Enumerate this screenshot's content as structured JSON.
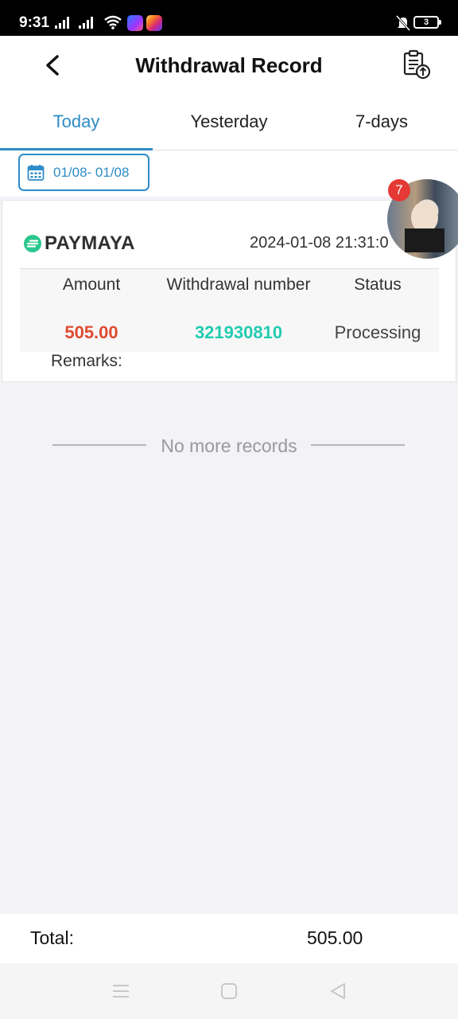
{
  "status_bar": {
    "time": "9:31",
    "battery": "3",
    "icons": [
      "signal-icon",
      "signal-icon",
      "wifi-icon",
      "messenger-icon",
      "instagram-icon",
      "mute-icon",
      "battery-icon"
    ]
  },
  "header": {
    "title": "Withdrawal Record",
    "back_icon": "chevron-left-icon",
    "record_icon": "clipboard-upload-icon"
  },
  "tabs": [
    {
      "label": "Today",
      "active": true
    },
    {
      "label": "Yesterday",
      "active": false
    },
    {
      "label": "7-days",
      "active": false
    }
  ],
  "filter": {
    "date_range": "01/08- 01/08",
    "icon": "calendar-icon"
  },
  "records": [
    {
      "method": "PAYMAYA",
      "time": "2024-01-08 21:31:0",
      "headers": {
        "amount": "Amount",
        "number": "Withdrawal number",
        "status": "Status"
      },
      "amount": "505.00",
      "number": "321930810",
      "status": "Processing",
      "remarks_label": "Remarks:"
    }
  ],
  "floating": {
    "badge": "7"
  },
  "empty_text": "No more records",
  "footer": {
    "total_label": "Total:",
    "total_value": "505.00"
  },
  "colors": {
    "accent": "#2d8cc6",
    "amount": "#e04a31",
    "number": "#22ccb0",
    "badge": "#e53935"
  }
}
